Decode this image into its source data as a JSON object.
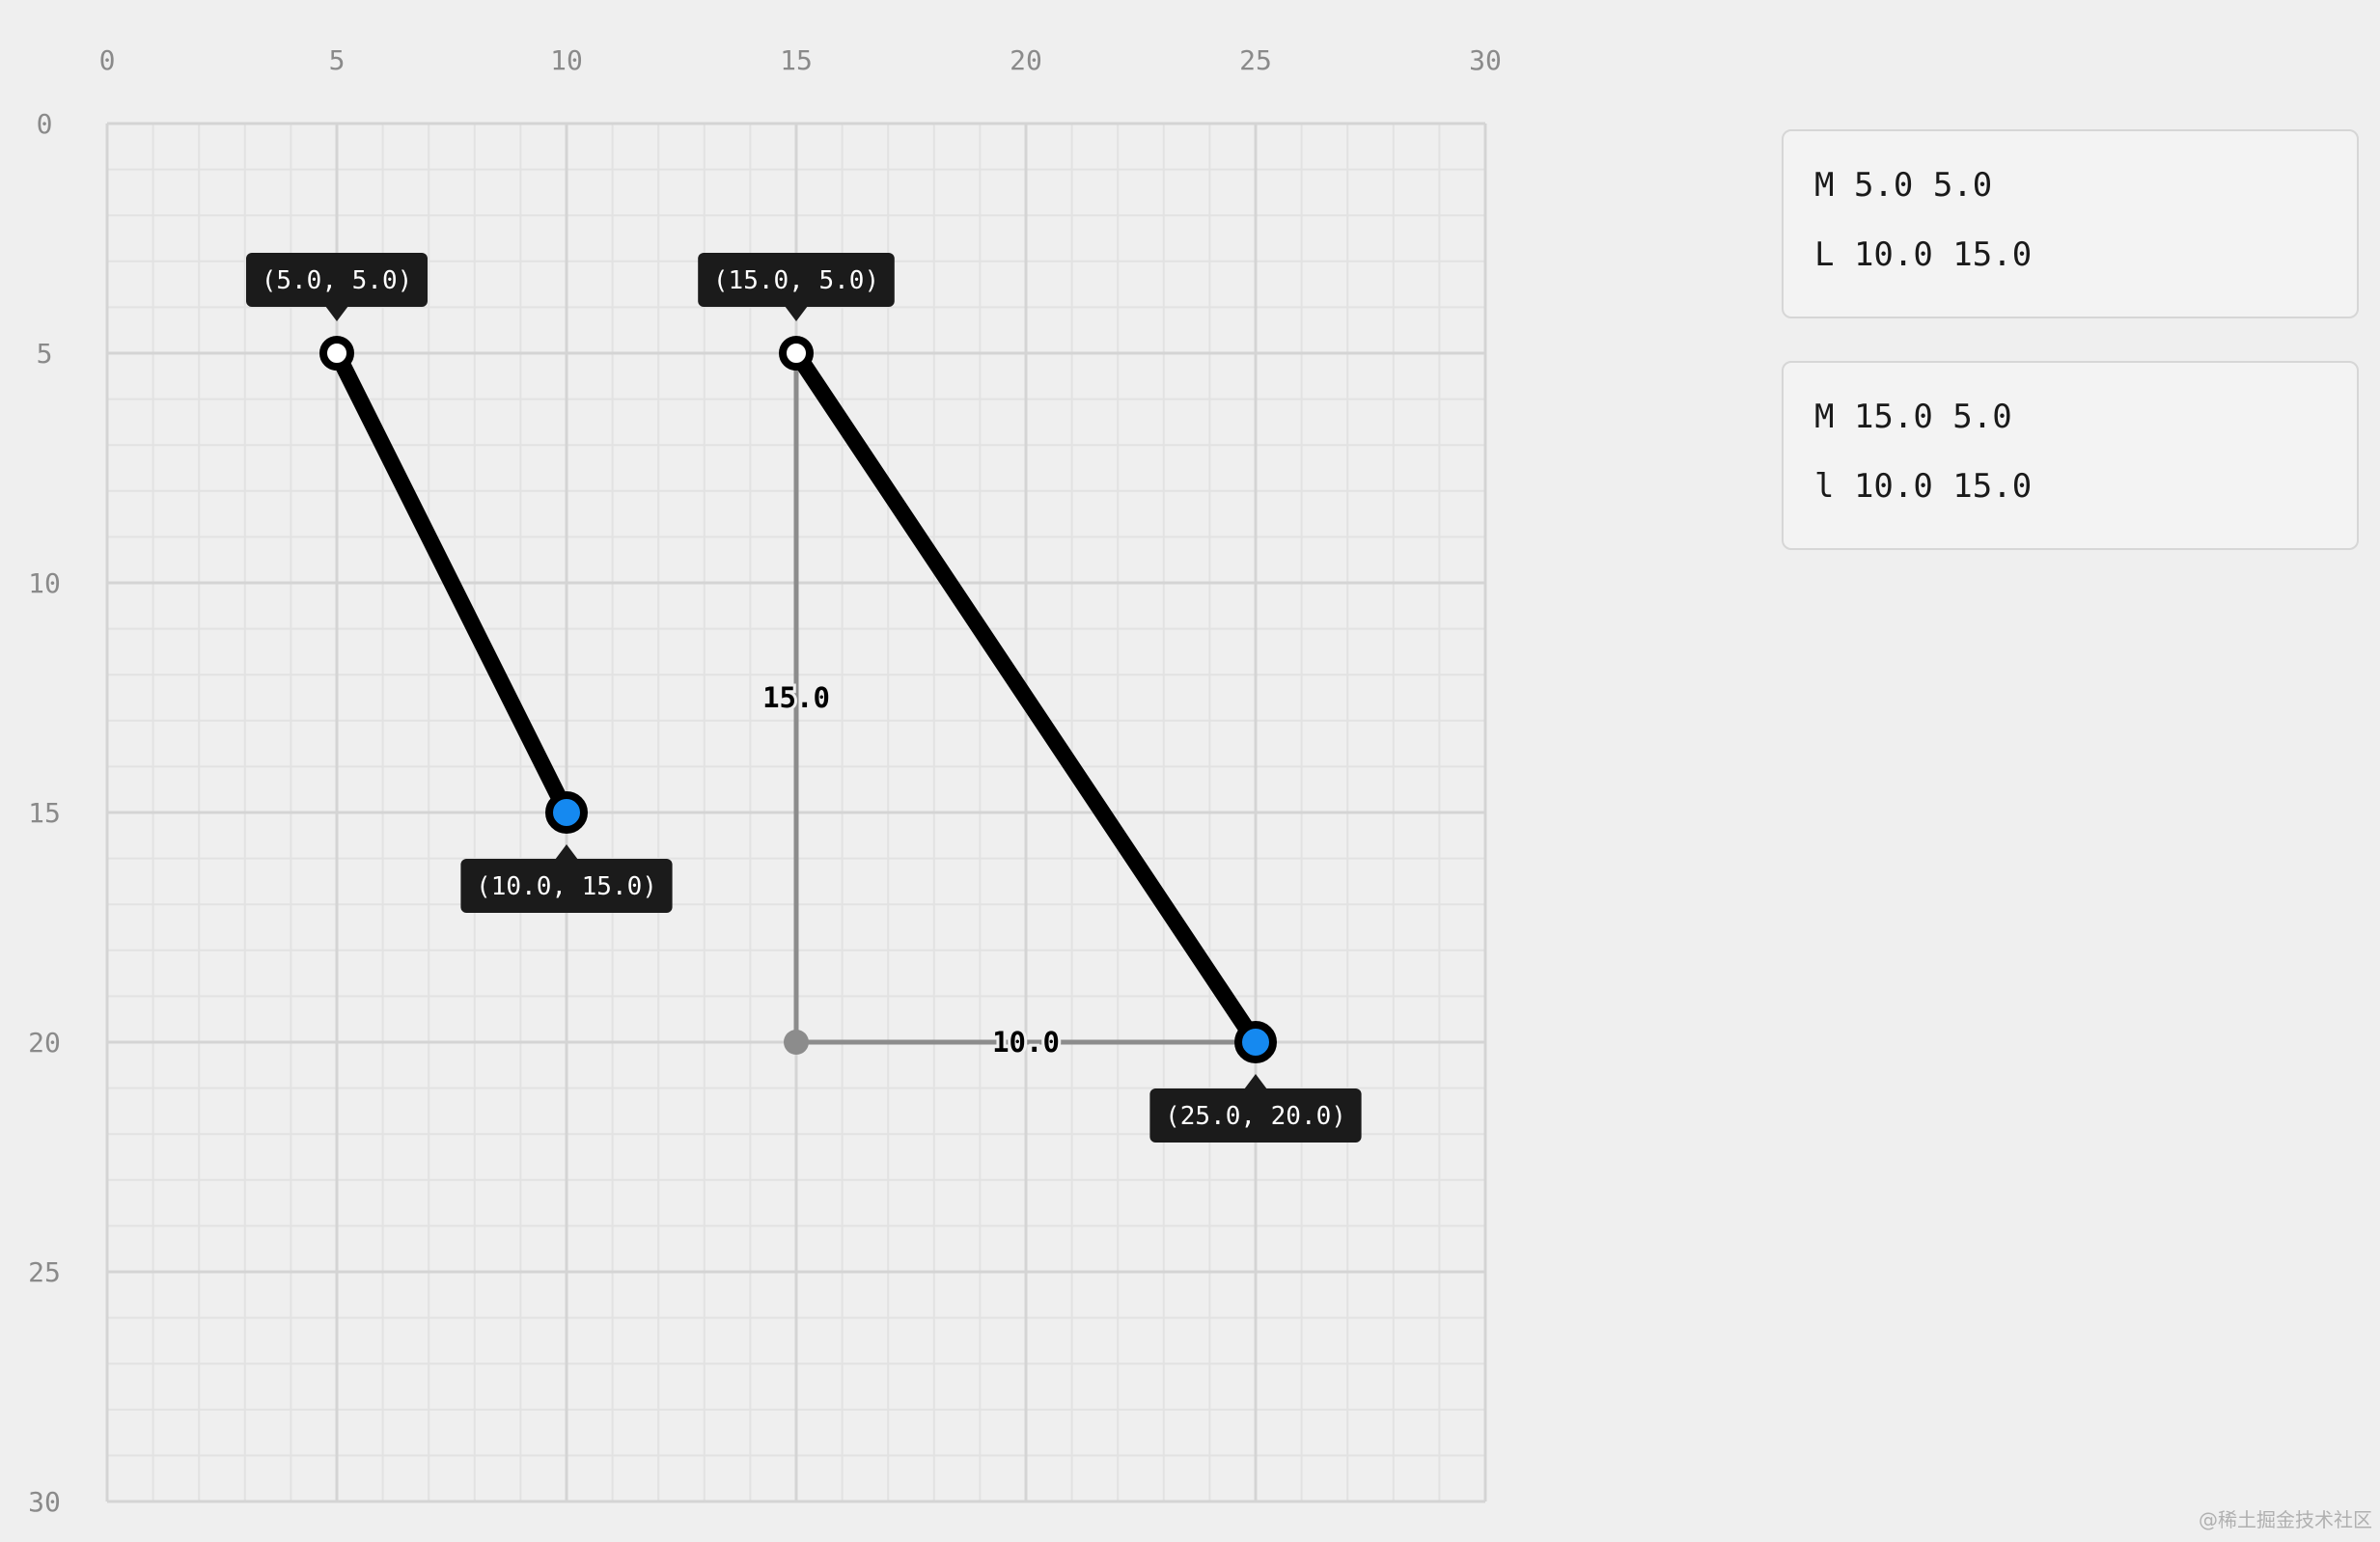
{
  "grid": {
    "x_range": [
      0,
      30
    ],
    "y_range": [
      0,
      30
    ],
    "major_step": 5,
    "minor_step": 1,
    "x_tick_labels": [
      "0",
      "5",
      "10",
      "15",
      "20",
      "25",
      "30"
    ],
    "y_tick_labels": [
      "0",
      "5",
      "10",
      "15",
      "20",
      "25",
      "30"
    ]
  },
  "segments": [
    {
      "id": "absolute-segment",
      "start": {
        "x": 5,
        "y": 5,
        "label": "(5.0, 5.0)",
        "label_side": "above"
      },
      "end": {
        "x": 10,
        "y": 15,
        "label": "(10.0, 15.0)",
        "label_side": "below"
      }
    },
    {
      "id": "relative-segment",
      "start": {
        "x": 15,
        "y": 5,
        "label": "(15.0, 5.0)",
        "label_side": "above"
      },
      "end": {
        "x": 25,
        "y": 20,
        "label": "(25.0, 20.0)",
        "label_side": "below"
      }
    }
  ],
  "delta_guides": {
    "corner": {
      "x": 15,
      "y": 20
    },
    "dy_label": "15.0",
    "dx_label": "10.0"
  },
  "path_panels": [
    {
      "lines": [
        "M 5.0 5.0",
        "L 10.0 15.0"
      ]
    },
    {
      "lines": [
        "M 15.0 5.0",
        "l 10.0 15.0"
      ]
    }
  ],
  "colors": {
    "background": "#efefef",
    "grid_minor": "#e2e2e2",
    "grid_major": "#d4d4d4",
    "tick_text": "#8a8a8a",
    "segment": "#000000",
    "end_point": "#1589f0",
    "guide": "#8c8c8c",
    "tooltip_bg": "#1b1b1b",
    "tooltip_text": "#ffffff"
  },
  "watermark": "@稀土掘金技术社区"
}
